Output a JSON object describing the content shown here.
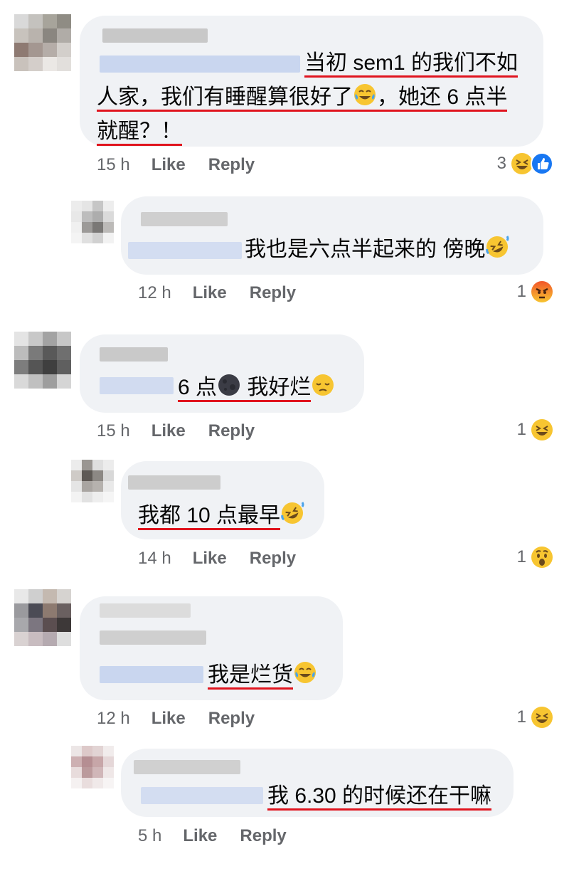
{
  "comments": [
    {
      "line1": "当初 sem1 的我们不如",
      "line2a": "人家，我们有睡醒算很好了",
      "line2b": "，她还 6 点半",
      "line3": "就醒？！",
      "time": "15 h",
      "like": "Like",
      "reply": "Reply",
      "reaction_count": "3",
      "reaction_icons": [
        "haha-icon",
        "like-icon"
      ]
    },
    {
      "text": "我也是六点半起来的 傍晚",
      "time": "12 h",
      "like": "Like",
      "reply": "Reply",
      "reaction_count": "1",
      "reaction_icons": [
        "angry-icon"
      ]
    },
    {
      "text_a": "6 点",
      "text_b": " 我好烂",
      "time": "15 h",
      "like": "Like",
      "reply": "Reply",
      "reaction_count": "1",
      "reaction_icons": [
        "haha-icon"
      ]
    },
    {
      "text": "我都 10 点最早",
      "time": "14 h",
      "like": "Like",
      "reply": "Reply",
      "reaction_count": "1",
      "reaction_icons": [
        "wow-icon"
      ]
    },
    {
      "text": "我是烂货",
      "time": "12 h",
      "like": "Like",
      "reply": "Reply",
      "reaction_count": "1",
      "reaction_icons": [
        "haha-icon"
      ]
    },
    {
      "text": "我 6.30 的时候还在干嘛",
      "time": "5 h",
      "like": "Like",
      "reply": "Reply"
    }
  ],
  "colors": {
    "bubble": "#f0f2f5",
    "underline": "#e0141e",
    "meta_text": "#65676b",
    "tag_blur": "#c9d6ef",
    "like_blue": "#1877f2"
  }
}
